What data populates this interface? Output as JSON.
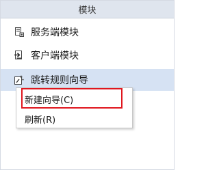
{
  "panel": {
    "title": "模块",
    "items": [
      {
        "label": "服务端模块",
        "icon": "server-module-icon"
      },
      {
        "label": "客户端模块",
        "icon": "client-module-icon"
      },
      {
        "label": "跳转规则向导",
        "icon": "redirect-wizard-icon",
        "selected": true
      }
    ]
  },
  "context_menu": {
    "items": [
      {
        "label": "新建向导(C)"
      },
      {
        "label": "刷新(R)"
      }
    ]
  },
  "colors": {
    "header_bg": "#dfe5ee",
    "selected_bg": "#d6e2f3",
    "highlight": "#e0161e"
  }
}
